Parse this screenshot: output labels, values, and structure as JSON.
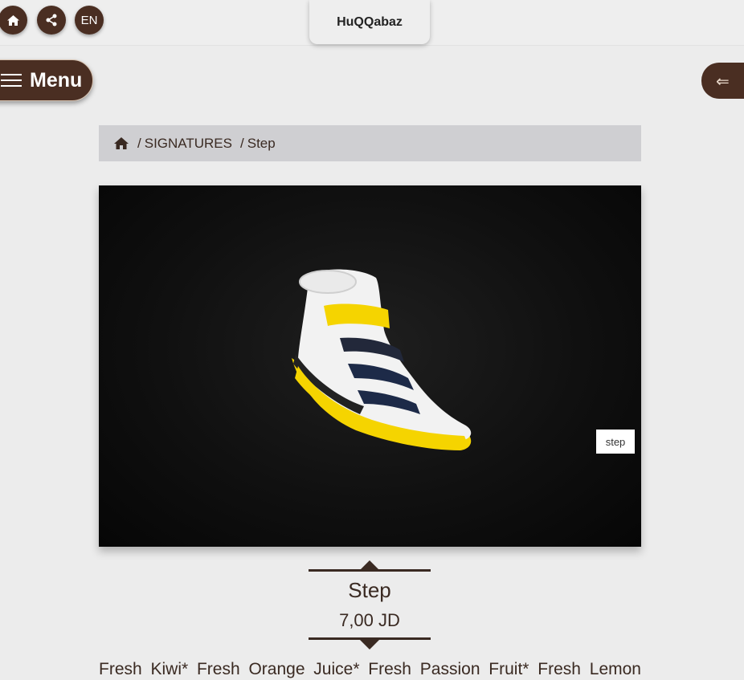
{
  "topbar": {
    "home_icon": "home-icon",
    "share_icon": "share-icon",
    "language": "EN",
    "logo_text": "HuQQabaz"
  },
  "menu": {
    "label": "Menu"
  },
  "back": {
    "icon": "back-arrow-icon",
    "glyph": "⇐"
  },
  "breadcrumb": {
    "items": [
      "SIGNATURES",
      "Step"
    ]
  },
  "product": {
    "image_tag": "step",
    "title": "Step",
    "price": "7,00 JD",
    "description": "Fresh Kiwi* Fresh Orange Juice* Fresh Passion Fruit* Fresh Lemon"
  },
  "colors": {
    "brand_brown": "#4a2e22",
    "background": "#ececec",
    "breadcrumb_bg": "#cfcfd2"
  }
}
